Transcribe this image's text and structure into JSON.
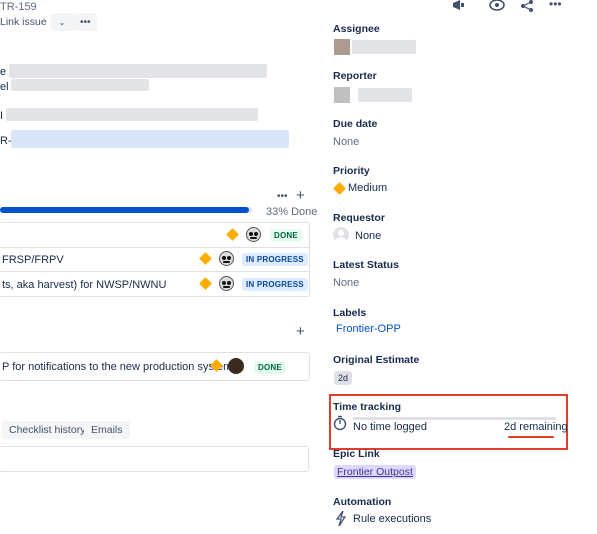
{
  "header": {
    "issue_key": "TR-159",
    "link_issue": "Link issue",
    "dropdown_icon": "chevron-down-icon",
    "more_icon": "more-icon",
    "top_icons": [
      "megaphone-icon",
      "eye-icon",
      "share-icon",
      "more-icon"
    ]
  },
  "description": {
    "line_fragments": [
      "e",
      "el",
      "I",
      "R-"
    ]
  },
  "child_issues": {
    "progress_label": "33% Done",
    "progress_fraction": 0.33,
    "items": [
      {
        "summary": "",
        "status": "DONE"
      },
      {
        "summary": "FRSP/FRPV",
        "status": "IN PROGRESS"
      },
      {
        "summary": "ts, aka harvest) for NWSP/NWNU",
        "status": "IN PROGRESS"
      }
    ]
  },
  "linked_issues": {
    "items": [
      {
        "summary": "P for notifications to the new production system",
        "status": "DONE"
      }
    ]
  },
  "activity": {
    "tabs": [
      "Checklist history",
      "Emails"
    ]
  },
  "sidebar": {
    "assignee": {
      "label": "Assignee"
    },
    "reporter": {
      "label": "Reporter"
    },
    "due_date": {
      "label": "Due date",
      "value": "None"
    },
    "priority": {
      "label": "Priority",
      "value": "Medium",
      "color": "#ffab00"
    },
    "requestor": {
      "label": "Requestor",
      "value": "None"
    },
    "latest_status": {
      "label": "Latest Status",
      "value": "None"
    },
    "labels": {
      "label": "Labels",
      "value": "Frontier-OPP"
    },
    "original_estimate": {
      "label": "Original Estimate",
      "value": "2d"
    },
    "time_tracking": {
      "label": "Time tracking",
      "logged": "No time logged",
      "remaining": "2d remaining",
      "highlight_color": "#e03e2d"
    },
    "epic_link": {
      "label": "Epic Link",
      "value": "Frontier Outpost"
    },
    "automation": {
      "label": "Automation",
      "value": "Rule executions"
    }
  }
}
